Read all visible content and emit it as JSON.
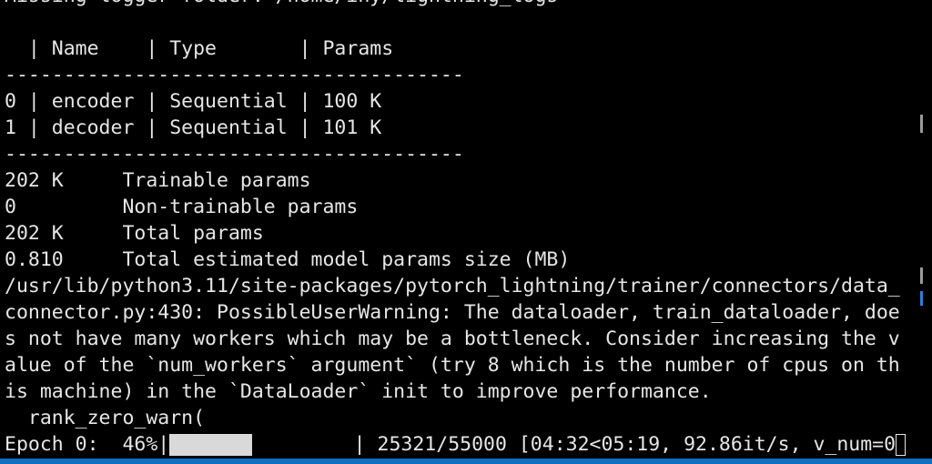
{
  "terminal": {
    "lines": [
      "Missing logger folder: /home/iny/lightning_logs",
      "",
      "  | Name    | Type       | Params",
      "---------------------------------------",
      "0 | encoder | Sequential | 100 K",
      "1 | decoder | Sequential | 101 K",
      "---------------------------------------",
      "202 K     Trainable params",
      "0         Non-trainable params",
      "202 K     Total params",
      "0.810     Total estimated model params size (MB)",
      "/usr/lib/python3.11/site-packages/pytorch_lightning/trainer/connectors/data_",
      "connector.py:430: PossibleUserWarning: The dataloader, train_dataloader, doe",
      "s not have many workers which may be a bottleneck. Consider increasing the v",
      "alue of the `num_workers` argument` (try 8 which is the number of cpus on th",
      "is machine) in the `DataLoader` init to improve performance.",
      "  rank_zero_warn("
    ],
    "progress": {
      "prefix": "Epoch 0:  46%|",
      "fraction": 0.46,
      "suffix": "| 25321/55000 [04:32<05:19, 92.86it/s, v_num=0"
    }
  },
  "colors": {
    "background": "#000000",
    "text": "#e6e6e6",
    "progress_fill": "#d9d9d9",
    "status_bar": "#0e6fc0"
  }
}
